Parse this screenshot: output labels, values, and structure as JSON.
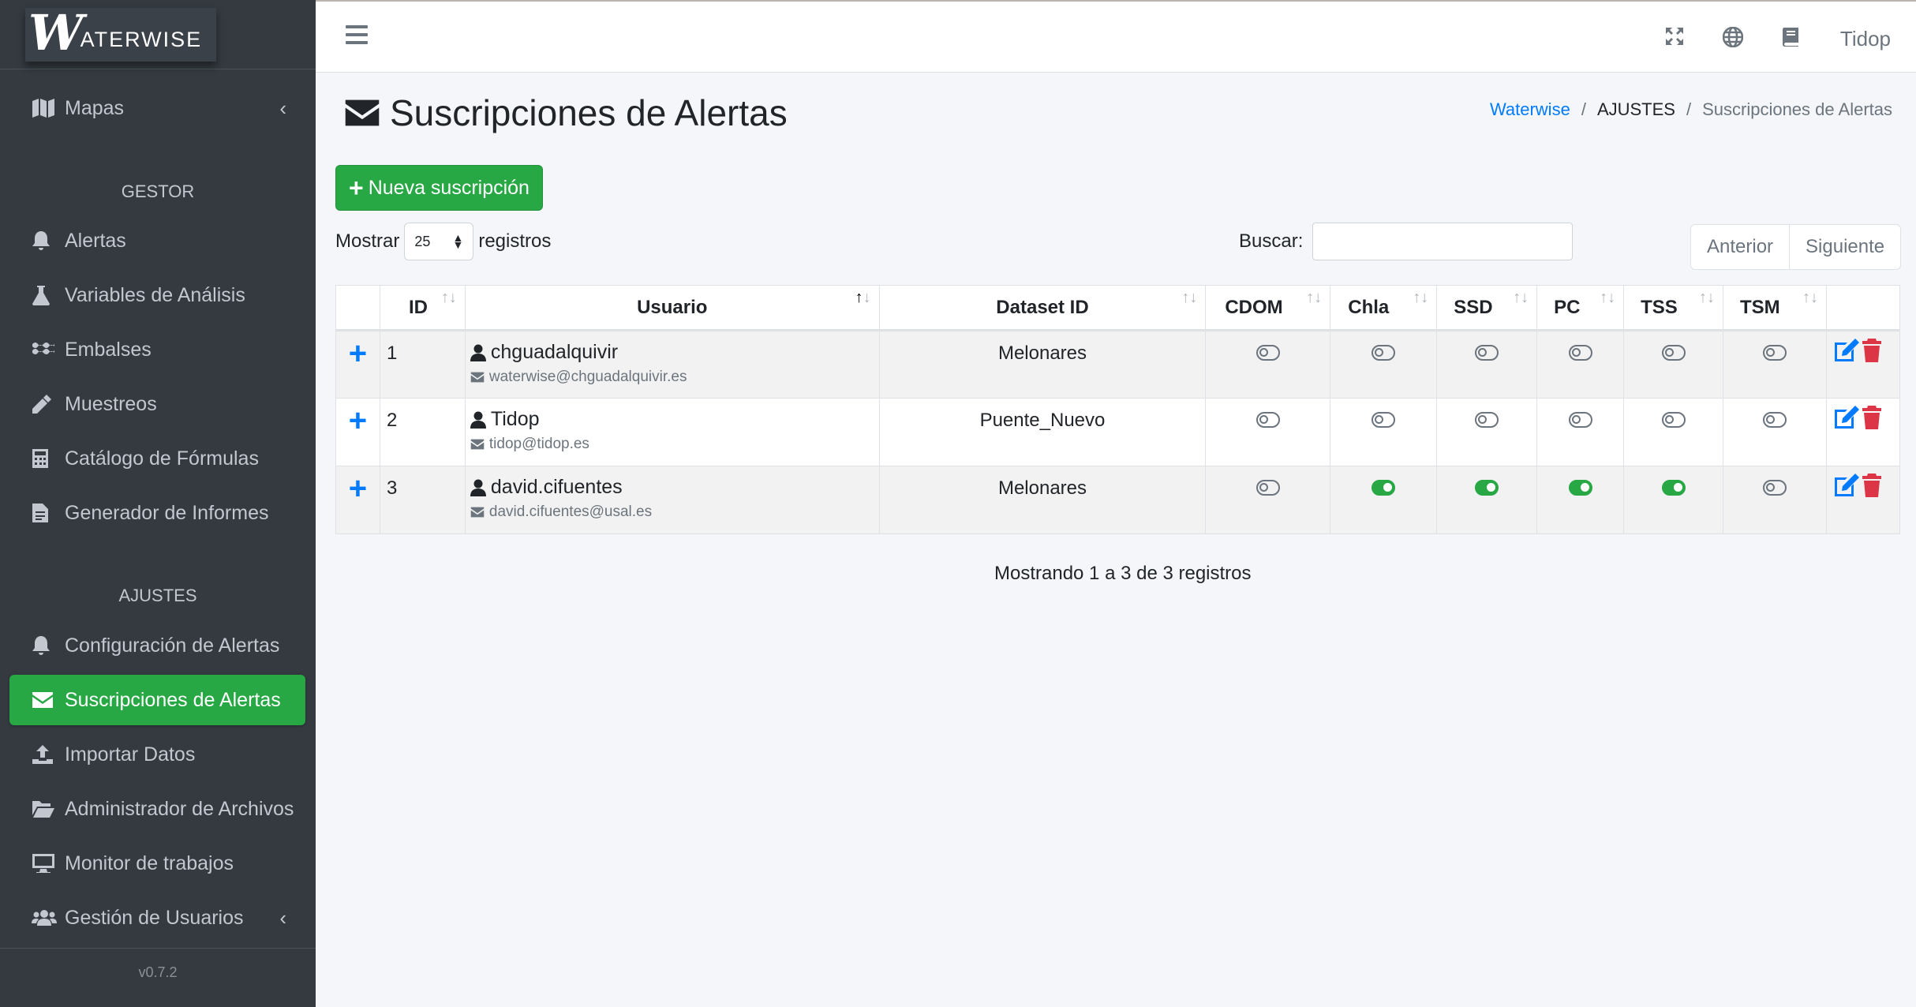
{
  "brand": {
    "logo_mark": "W",
    "logo_text": "ATERWISE"
  },
  "sidebar": {
    "top_items": [
      {
        "label": "Mapas",
        "icon": "map-icon"
      }
    ],
    "sections": [
      {
        "header": "GESTOR",
        "items": [
          {
            "label": "Alertas",
            "icon": "bell-icon"
          },
          {
            "label": "Variables de Análisis",
            "icon": "flask-icon"
          },
          {
            "label": "Embalses",
            "icon": "water-icon"
          },
          {
            "label": "Muestreos",
            "icon": "eyedropper-icon"
          },
          {
            "label": "Catálogo de Fórmulas",
            "icon": "calculator-icon"
          },
          {
            "label": "Generador de Informes",
            "icon": "file-report-icon"
          }
        ]
      },
      {
        "header": "AJUSTES",
        "items": [
          {
            "label": "Configuración de Alertas",
            "icon": "bell-icon"
          },
          {
            "label": "Suscripciones de Alertas",
            "icon": "envelope-icon",
            "active": true
          },
          {
            "label": "Importar Datos",
            "icon": "upload-icon"
          },
          {
            "label": "Administrador de Archivos",
            "icon": "folder-open-icon"
          },
          {
            "label": "Monitor de trabajos",
            "icon": "desktop-icon"
          },
          {
            "label": "Gestión de Usuarios",
            "icon": "users-icon"
          }
        ]
      }
    ],
    "version": "v0.7.2"
  },
  "topbar": {
    "user": "Tidop",
    "icons": [
      "menu-icon",
      "expand-icon",
      "globe-icon",
      "book-icon"
    ]
  },
  "page": {
    "title": "Suscripciones de Alertas",
    "breadcrumb": [
      "Waterwise",
      "AJUSTES",
      "Suscripciones de Alertas"
    ]
  },
  "toolbar": {
    "new_button": "Nueva suscripción",
    "show_label": "Mostrar",
    "page_size": "25",
    "records_label": "registros",
    "search_label": "Buscar:",
    "search_value": "",
    "prev": "Anterior",
    "next": "Siguiente"
  },
  "table": {
    "columns": [
      "ID",
      "Usuario",
      "Dataset ID",
      "CDOM",
      "Chla",
      "SSD",
      "PC",
      "TSS",
      "TSM"
    ],
    "rows": [
      {
        "id": "1",
        "user": "chguadalquivir",
        "email": "waterwise@chguadalquivir.es",
        "dataset": "Melonares",
        "toggles": [
          false,
          false,
          false,
          false,
          false,
          false
        ]
      },
      {
        "id": "2",
        "user": "Tidop",
        "email": "tidop@tidop.es",
        "dataset": "Puente_Nuevo",
        "toggles": [
          false,
          false,
          false,
          false,
          false,
          false
        ]
      },
      {
        "id": "3",
        "user": "david.cifuentes",
        "email": "david.cifuentes@usal.es",
        "dataset": "Melonares",
        "toggles": [
          false,
          true,
          true,
          true,
          true,
          false
        ]
      }
    ]
  },
  "footer_info": "Mostrando 1 a 3 de 3 registros",
  "colors": {
    "sidebar": "#343a40",
    "active": "#28a745",
    "link": "#007bff",
    "danger": "#dc3545"
  }
}
